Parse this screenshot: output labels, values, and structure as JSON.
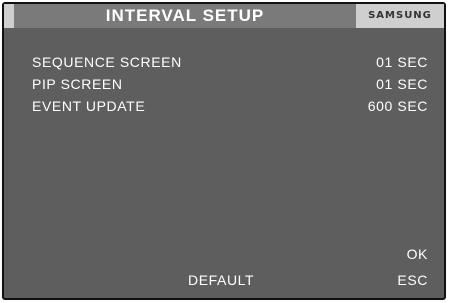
{
  "window": {
    "title": "INTERVAL SETUP",
    "brand": "SAMSUNG"
  },
  "settings": [
    {
      "label": "SEQUENCE SCREEN",
      "value": "01 SEC"
    },
    {
      "label": "PIP SCREEN",
      "value": "01 SEC"
    },
    {
      "label": "EVENT UPDATE",
      "value": "600 SEC"
    }
  ],
  "buttons": {
    "ok": "OK",
    "default": "DEFAULT",
    "esc": "ESC"
  },
  "colors": {
    "background": "#5e5e5e",
    "title_strip": "#7a7a7a",
    "title_bar": "#cfcfcf",
    "text": "#ffffff",
    "border": "#111111"
  }
}
